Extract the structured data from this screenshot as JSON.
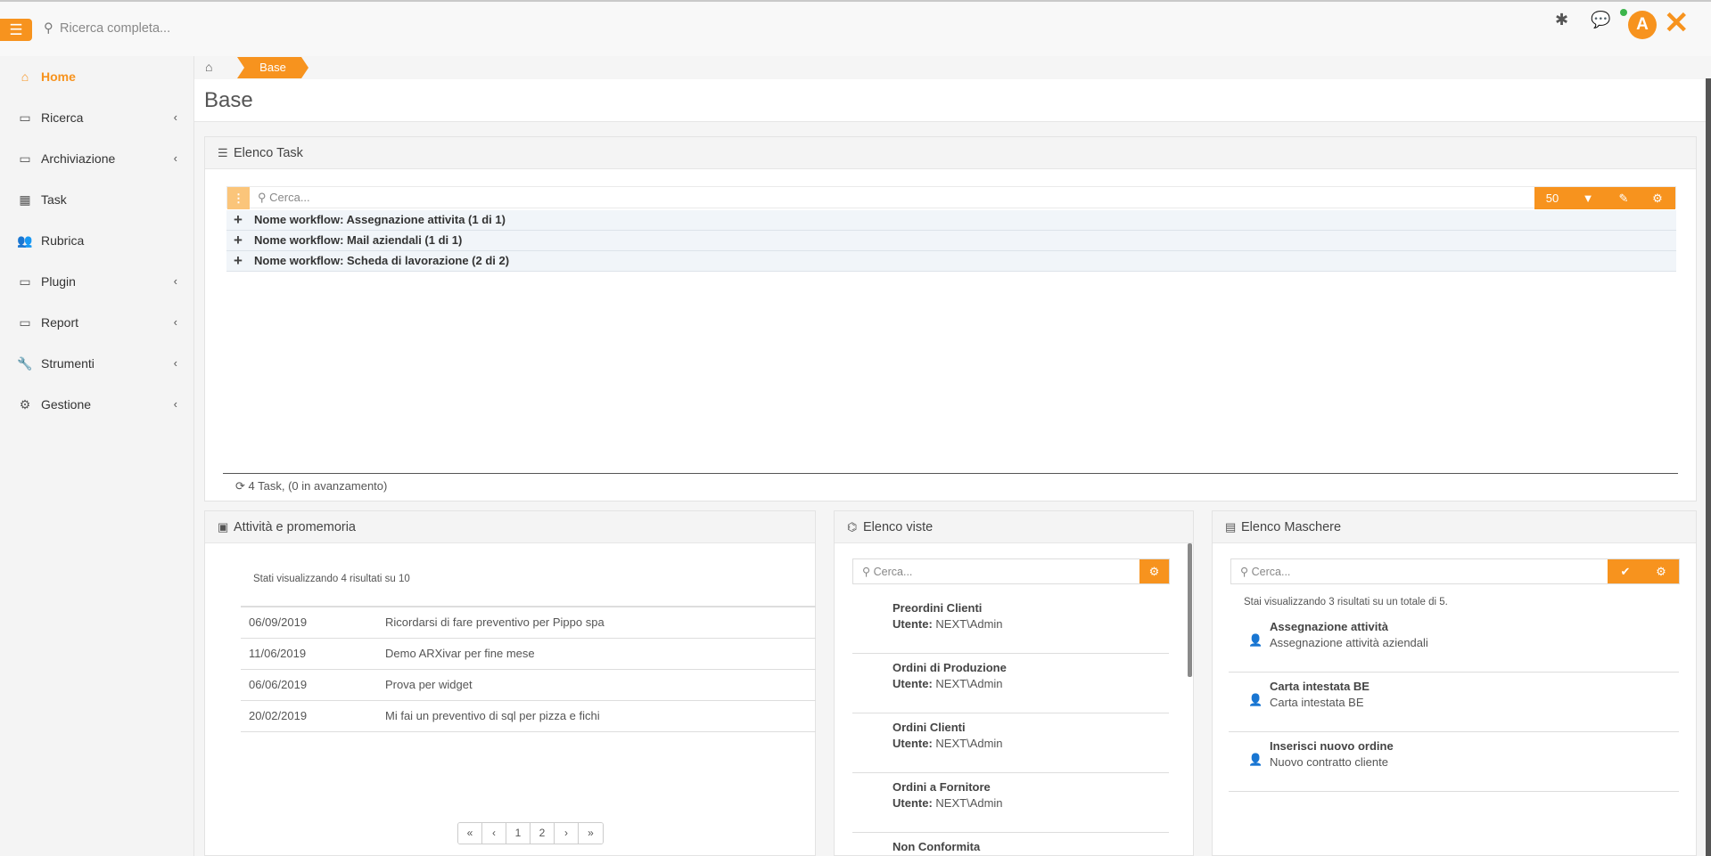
{
  "topbar": {
    "search_placeholder": "Ricerca completa...",
    "avatar_letter": "A",
    "brand_color": "#f7931e"
  },
  "sidebar": {
    "items": [
      {
        "label": "Home",
        "icon": "home-icon",
        "active": true
      },
      {
        "label": "Ricerca",
        "icon": "folder-icon"
      },
      {
        "label": "Archiviazione",
        "icon": "folder-icon"
      },
      {
        "label": "Task",
        "icon": "table-icon"
      },
      {
        "label": "Rubrica",
        "icon": "users-icon"
      },
      {
        "label": "Plugin",
        "icon": "folder-icon"
      },
      {
        "label": "Report",
        "icon": "folder-icon"
      },
      {
        "label": "Strumenti",
        "icon": "wrench-icon"
      },
      {
        "label": "Gestione",
        "icon": "gears-icon"
      }
    ]
  },
  "breadcrumb": {
    "current": "Base"
  },
  "page": {
    "title": "Base"
  },
  "tasks": {
    "title": "Elenco Task",
    "search_placeholder": "Cerca...",
    "page_size": "50",
    "groups": [
      "Nome workflow: Assegnazione attivita  (1 di 1)",
      "Nome workflow: Mail aziendali  (1 di 1)",
      "Nome workflow: Scheda di lavorazione  (2 di 2)"
    ],
    "footer": "4 Task, (0 in avanzamento)"
  },
  "activities": {
    "title": "Attività e promemoria",
    "info": "Stati visualizzando 4 risultati su 10",
    "rows": [
      {
        "date": "06/09/2019",
        "text": "Ricordarsi di fare preventivo per Pippo spa"
      },
      {
        "date": "11/06/2019",
        "text": "Demo ARXivar per fine mese"
      },
      {
        "date": "06/06/2019",
        "text": "Prova per widget"
      },
      {
        "date": "20/02/2019",
        "text": "Mi fai un preventivo di sql per pizza e fichi"
      }
    ],
    "pager": [
      "«",
      "‹",
      "1",
      "2",
      "›",
      "»"
    ]
  },
  "views": {
    "title": "Elenco viste",
    "search_placeholder": "Cerca...",
    "user_label": "Utente:",
    "items": [
      {
        "name": "Preordini Clienti",
        "user": "NEXT\\Admin"
      },
      {
        "name": "Ordini di Produzione",
        "user": "NEXT\\Admin"
      },
      {
        "name": "Ordini Clienti",
        "user": "NEXT\\Admin"
      },
      {
        "name": "Ordini a Fornitore",
        "user": "NEXT\\Admin"
      },
      {
        "name": "Non Conformita",
        "user": ""
      }
    ]
  },
  "masks": {
    "title": "Elenco Maschere",
    "search_placeholder": "Cerca...",
    "info": "Stai visualizzando 3 risultati su un totale di 5.",
    "items": [
      {
        "name": "Assegnazione attività",
        "desc": "Assegnazione attività aziendali"
      },
      {
        "name": "Carta intestata BE",
        "desc": "Carta intestata BE"
      },
      {
        "name": "Inserisci nuovo ordine",
        "desc": "Nuovo contratto cliente"
      }
    ]
  }
}
